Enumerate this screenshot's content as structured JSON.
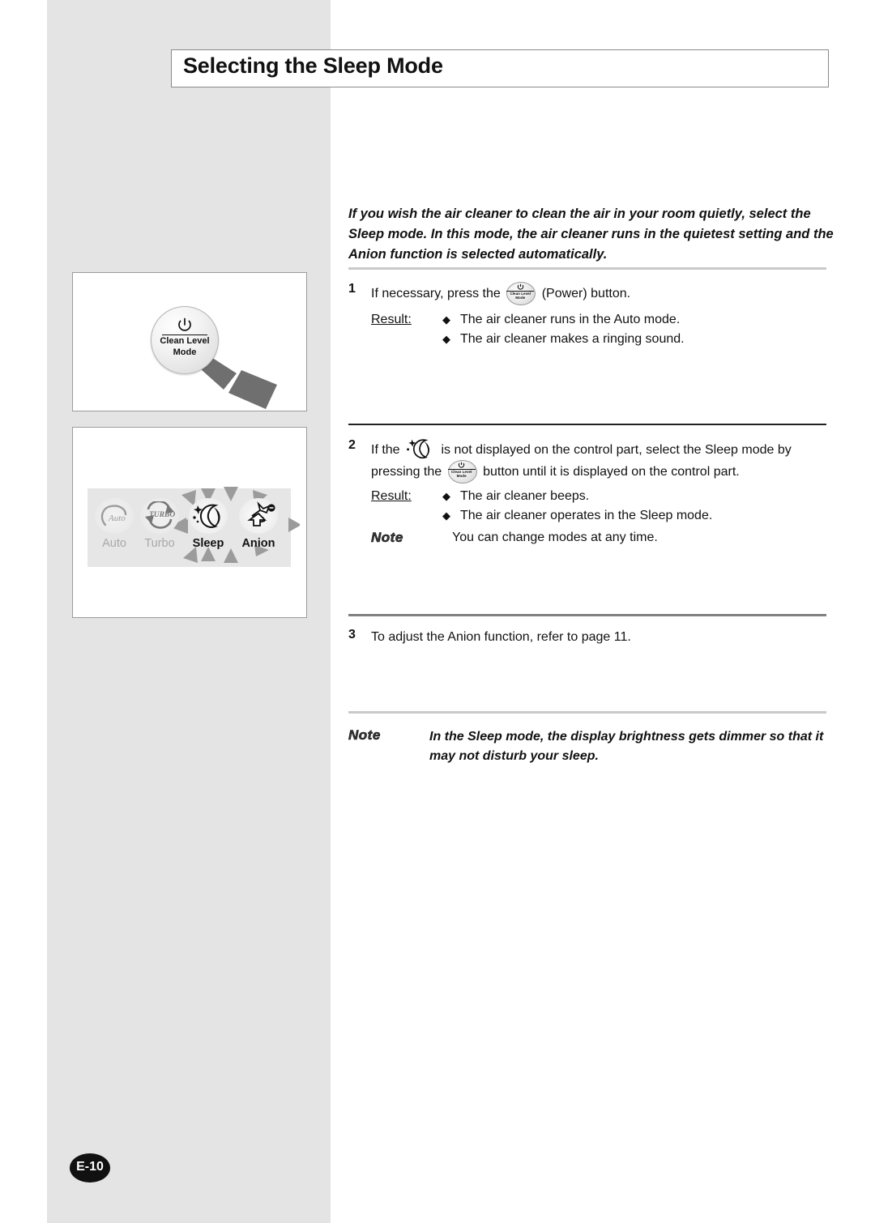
{
  "page": {
    "title": "Selecting the Sleep Mode",
    "page_label": "E-10"
  },
  "intro": "If you wish the air cleaner to clean the air in your room quietly, select the Sleep mode. In this mode, the air cleaner runs in the quietest setting and the Anion function is selected automatically.",
  "steps": [
    {
      "number": "1",
      "text_before": "If necessary, press the",
      "inline_icon": "power-button-icon",
      "text_after": "(Power) button.",
      "result_label": "Result:",
      "results": [
        "The air cleaner runs in the Auto mode.",
        "The air cleaner makes a ringing sound."
      ]
    },
    {
      "number": "2",
      "text_a": "If the",
      "inline_icon_1": "sleep-moon-icon",
      "text_b": "is not displayed on the control part, select the Sleep mode by pressing the",
      "inline_icon_2": "power-button-icon",
      "text_c": "button until it is displayed on the control part.",
      "result_label": "Result:",
      "results": [
        "The air cleaner beeps.",
        "The air cleaner operates in the Sleep mode."
      ],
      "note_word": "Note",
      "note_text": "You can change modes at any time."
    },
    {
      "number": "3",
      "text": "To adjust the Anion function, refer to page 11."
    }
  ],
  "bottom_note": {
    "word": "Note",
    "text": "In the Sleep mode, the display brightness gets dimmer so that it may not disturb your sleep."
  },
  "illustration_1": {
    "name": "power-button-illustration",
    "button_glyph": "power-symbol-icon",
    "label_line1": "Clean Level",
    "label_line2": "Mode",
    "pointer": "gray-arrow-pointer"
  },
  "illustration_2": {
    "name": "control-panel-indicators",
    "cells": [
      {
        "label": "Auto",
        "icon": "auto-fan-icon",
        "active": "false"
      },
      {
        "label": "Turbo",
        "icon": "turbo-icon",
        "active": "false"
      },
      {
        "label": "Sleep",
        "icon": "sleep-moon-icon",
        "active": "true"
      },
      {
        "label": "Anion",
        "icon": "anion-leaf-icon",
        "active": "true"
      }
    ],
    "highlight": "radiating-arrows"
  },
  "colors": {
    "band_gray": "#e4e4e4",
    "strip_gray": "#e6e6e6",
    "ray_gray": "#9b9b9b",
    "dim_label": "#a8a8a8",
    "text": "#111111",
    "badge": "#111111"
  },
  "mini_button": {
    "glyph": "⏻",
    "line1": "Clean Level",
    "line2": "Mode"
  }
}
